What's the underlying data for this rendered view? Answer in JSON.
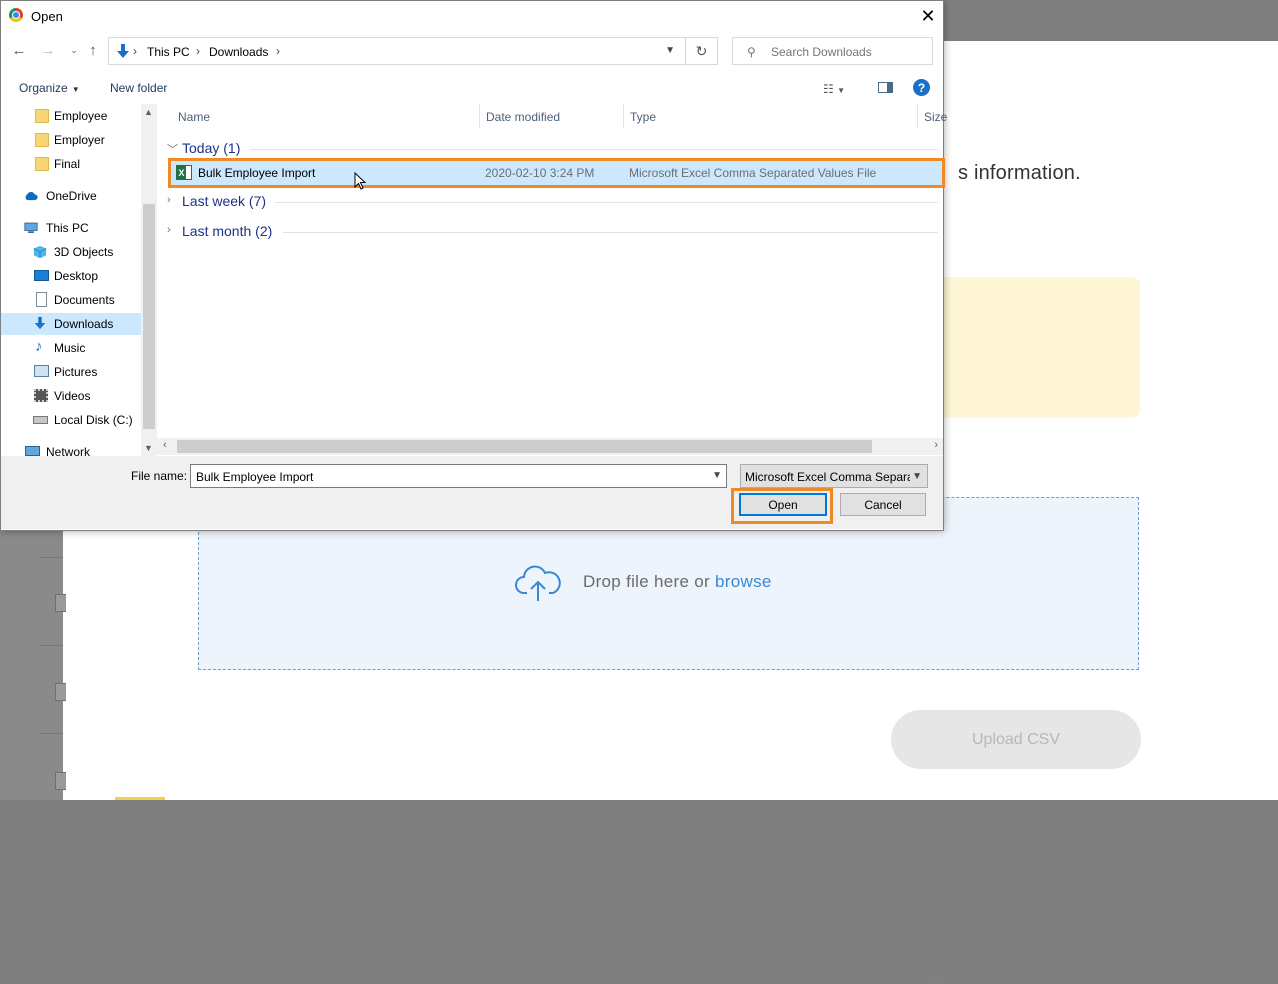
{
  "dialog": {
    "title": "Open",
    "close_glyph": "✕"
  },
  "address": {
    "crumbs": [
      "This PC",
      "Downloads"
    ],
    "separator": "›"
  },
  "search": {
    "placeholder": "Search Downloads"
  },
  "toolbar": {
    "organize": "Organize",
    "new_folder": "New folder"
  },
  "nav_pane": {
    "items": [
      {
        "label": "Employee",
        "icon": "folder-icon"
      },
      {
        "label": "Employer",
        "icon": "folder-icon"
      },
      {
        "label": "Final",
        "icon": "folder-icon"
      },
      {
        "label": "OneDrive",
        "icon": "cloud-icon"
      },
      {
        "label": "This PC",
        "icon": "computer-icon"
      },
      {
        "label": "3D Objects",
        "icon": "cube-icon"
      },
      {
        "label": "Desktop",
        "icon": "desktop-icon"
      },
      {
        "label": "Documents",
        "icon": "document-icon"
      },
      {
        "label": "Downloads",
        "icon": "download-icon",
        "selected": true
      },
      {
        "label": "Music",
        "icon": "music-icon"
      },
      {
        "label": "Pictures",
        "icon": "picture-icon"
      },
      {
        "label": "Videos",
        "icon": "video-icon"
      },
      {
        "label": "Local Disk (C:)",
        "icon": "disk-icon"
      },
      {
        "label": "Network",
        "icon": "network-icon"
      }
    ]
  },
  "columns": [
    "Name",
    "Date modified",
    "Type",
    "Size"
  ],
  "groups": [
    {
      "label": "Today (1)",
      "expanded": true
    },
    {
      "label": "Last week (7)",
      "expanded": false
    },
    {
      "label": "Last month (2)",
      "expanded": false
    }
  ],
  "files": [
    {
      "name": "Bulk Employee Import",
      "date": "2020-02-10 3:24 PM",
      "type": "Microsoft Excel Comma Separated Values File"
    }
  ],
  "footer": {
    "file_name_label": "File name:",
    "file_name_value": "Bulk Employee Import",
    "file_type": "Microsoft Excel Comma Separated Values File",
    "open": "Open",
    "cancel": "Cancel"
  },
  "background": {
    "info_text": "s information.",
    "drop_text": "Drop file here or",
    "browse": "browse",
    "upload_button": "Upload CSV"
  },
  "colors": {
    "accent_highlight": "#f08a24",
    "selection": "#cce8ff",
    "link": "#3a87d6"
  }
}
